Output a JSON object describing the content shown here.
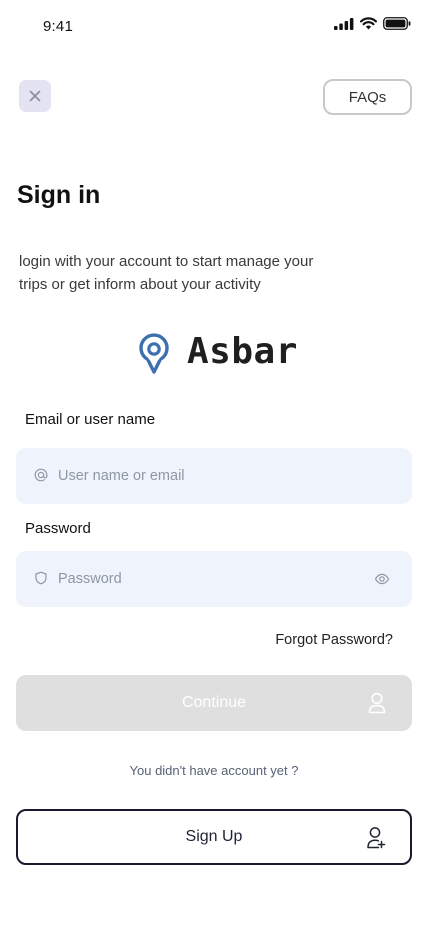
{
  "status_bar": {
    "time": "9:41",
    "icons": [
      "cellular-signal-icon",
      "wifi-icon",
      "battery-icon"
    ]
  },
  "header": {
    "close_icon": "close-icon",
    "faq_label": "FAQs"
  },
  "title": "Sign in",
  "subtitle": "login with your account to start manage your trips or get inform about your activity",
  "logo": {
    "text": "Asbar",
    "icon": "location-pin-logo-icon",
    "color": "#3e6fb1"
  },
  "form": {
    "email_label": "Email or user name",
    "email_placeholder": "User name or email",
    "email_icon": "at-sign-icon",
    "password_label": "Password",
    "password_placeholder": "Password",
    "password_icon": "shield-icon",
    "visibility_icon": "eye-icon"
  },
  "forgot_password": "Forgot Password?",
  "continue_label": "Continue",
  "continue_icon": "user-icon",
  "no_account_text": "You didn't have account yet ?",
  "signup_label": "Sign Up",
  "signup_icon": "user-plus-icon",
  "colors": {
    "input_bg": "#eff3fb",
    "disabled_button": "#dfdfdf",
    "close_button_bg": "#e4e3f1",
    "signup_border": "#1a1a2e"
  }
}
